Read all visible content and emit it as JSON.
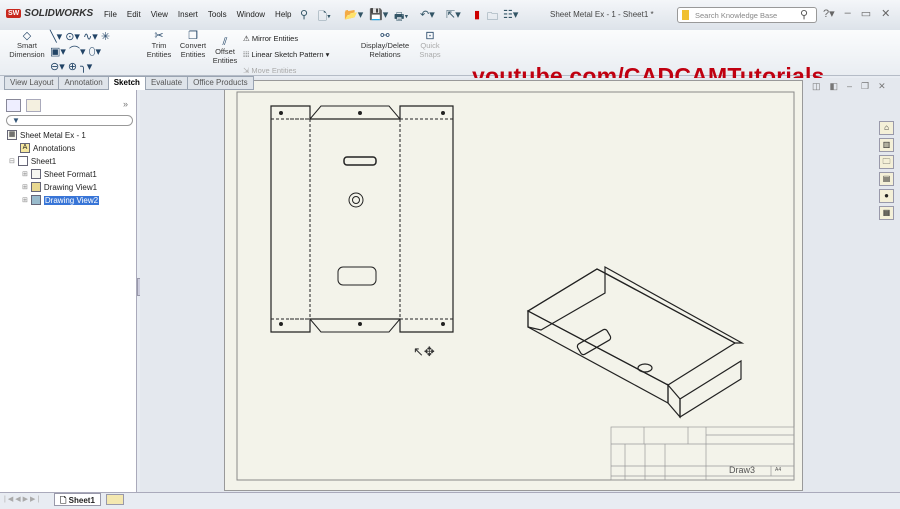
{
  "app": {
    "name": "SOLIDWORKS",
    "document_title": "Sheet Metal Ex - 1 - Sheet1 *"
  },
  "menu": [
    "File",
    "Edit",
    "View",
    "Insert",
    "Tools",
    "Window",
    "Help"
  ],
  "search": {
    "placeholder": "Search Knowledge Base"
  },
  "ribbon": {
    "smart_dimension": "Smart Dimension",
    "trim_entities": "Trim Entities",
    "convert_entities": "Convert Entities",
    "offset_entities": "Offset Entities",
    "mirror_entities": "Mirror Entities",
    "linear_sketch_pattern": "Linear Sketch Pattern",
    "move_entities": "Move Entities",
    "display_delete_relations": "Display/Delete Relations",
    "quick_snaps": "Quick Snaps"
  },
  "watermark": "youtube.com/CADCAMTutorials",
  "tabs": [
    {
      "label": "View Layout"
    },
    {
      "label": "Annotation"
    },
    {
      "label": "Sketch",
      "active": true
    },
    {
      "label": "Evaluate"
    },
    {
      "label": "Office Products"
    }
  ],
  "tree": {
    "root": "Sheet Metal Ex - 1",
    "items": [
      "Annotations",
      "Sheet1",
      "Sheet Format1",
      "Drawing View1",
      "Drawing View2"
    ],
    "selected": "Drawing View2"
  },
  "title_block": {
    "drawing_name": "Draw3",
    "sheet_size": "A4"
  },
  "sheet_tabs": [
    "Sheet1"
  ],
  "colors": {
    "accent": "#3875d7",
    "watermark": "#c00010",
    "brand": "#c8281e"
  }
}
